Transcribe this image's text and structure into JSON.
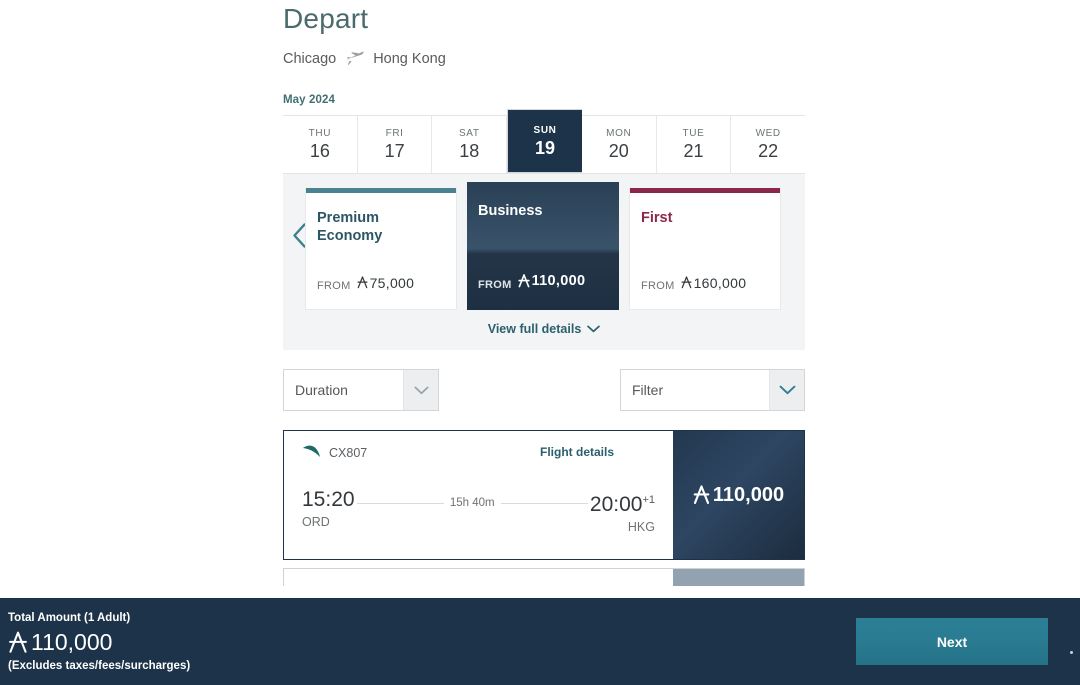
{
  "header": {
    "title": "Depart",
    "origin_city": "Chicago",
    "destination_city": "Hong Kong",
    "plane_icon": "plane-icon"
  },
  "calendar": {
    "month_label": "May 2024",
    "days": [
      {
        "dow": "THU",
        "date": "16",
        "selected": false
      },
      {
        "dow": "FRI",
        "date": "17",
        "selected": false
      },
      {
        "dow": "SAT",
        "date": "18",
        "selected": false
      },
      {
        "dow": "SUN",
        "date": "19",
        "selected": true
      },
      {
        "dow": "MON",
        "date": "20",
        "selected": false
      },
      {
        "dow": "TUE",
        "date": "21",
        "selected": false
      },
      {
        "dow": "WED",
        "date": "22",
        "selected": false
      }
    ]
  },
  "cabins": {
    "prev_arrow_icon": "chevron-left-icon",
    "items": [
      {
        "name": "Premium Economy",
        "from_label": "FROM",
        "price": "75,000",
        "accent": "#4a8292",
        "selected": false
      },
      {
        "name": "Business",
        "from_label": "FROM",
        "price": "110,000",
        "accent": "#1d3349",
        "selected": true
      },
      {
        "name": "First",
        "from_label": "FROM",
        "price": "160,000",
        "accent": "#8b2849",
        "selected": false
      }
    ],
    "view_full_details": "View full details",
    "view_full_details_icon": "chevron-down-icon"
  },
  "filters": {
    "duration": {
      "label": "Duration",
      "icon": "chevron-down-icon"
    },
    "filter": {
      "label": "Filter",
      "icon": "chevron-down-icon"
    }
  },
  "flights": [
    {
      "airline_icon": "cathay-brushwing-icon",
      "flight_number": "CX807",
      "details_link": "Flight details",
      "depart_time": "15:20",
      "depart_code": "ORD",
      "duration": "15h 40m",
      "arrive_time": "20:00",
      "arrive_day_offset": "+1",
      "arrive_code": "HKG",
      "price": "110,000",
      "currency_icon": "asia-miles-icon"
    }
  ],
  "footer": {
    "total_label": "Total Amount (1 Adult)",
    "total_amount": "110,000",
    "total_currency_icon": "asia-miles-icon",
    "excludes_note": "(Excludes taxes/fees/surcharges)",
    "next_button": "Next"
  },
  "colors": {
    "navy": "#1d3349",
    "teal": "#2b7f95",
    "link_teal": "#2b5f6e",
    "crimson": "#8b2849",
    "premium_accent": "#4a8292"
  }
}
